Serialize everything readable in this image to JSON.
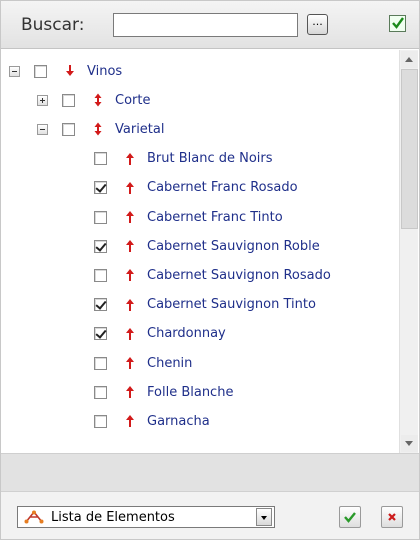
{
  "search": {
    "label": "Buscar:",
    "value": "",
    "browse_label": "..."
  },
  "tree": {
    "rows": [
      {
        "level": 0,
        "expander": "minus",
        "checked": false,
        "arrow": "down",
        "label": "Vinos"
      },
      {
        "level": 1,
        "expander": "plus",
        "checked": false,
        "arrow": "updown",
        "label": "Corte"
      },
      {
        "level": 1,
        "expander": "minus",
        "checked": false,
        "arrow": "updown",
        "label": "Varietal"
      },
      {
        "level": 2,
        "checked": false,
        "arrow": "up",
        "label": "Brut Blanc de Noirs"
      },
      {
        "level": 2,
        "checked": true,
        "arrow": "up",
        "label": "Cabernet Franc Rosado"
      },
      {
        "level": 2,
        "checked": false,
        "arrow": "up",
        "label": "Cabernet Franc Tinto"
      },
      {
        "level": 2,
        "checked": true,
        "arrow": "up",
        "label": "Cabernet Sauvignon Roble"
      },
      {
        "level": 2,
        "checked": false,
        "arrow": "up",
        "label": "Cabernet Sauvignon Rosado"
      },
      {
        "level": 2,
        "checked": true,
        "arrow": "up",
        "label": "Cabernet Sauvignon Tinto"
      },
      {
        "level": 2,
        "checked": true,
        "arrow": "up",
        "label": "Chardonnay"
      },
      {
        "level": 2,
        "checked": false,
        "arrow": "up",
        "label": "Chenin"
      },
      {
        "level": 2,
        "checked": false,
        "arrow": "up",
        "label": "Folle Blanche"
      },
      {
        "level": 2,
        "checked": false,
        "arrow": "up",
        "label": "Garnacha"
      }
    ]
  },
  "footer": {
    "view_select": {
      "selected": "Lista de Elementos",
      "icon": "hierarchy-icon"
    }
  },
  "colors": {
    "label": "#1f2f8a",
    "arrow": "#d21a1a",
    "ok": "#2a9a2a",
    "cancel": "#cc1a1a"
  }
}
